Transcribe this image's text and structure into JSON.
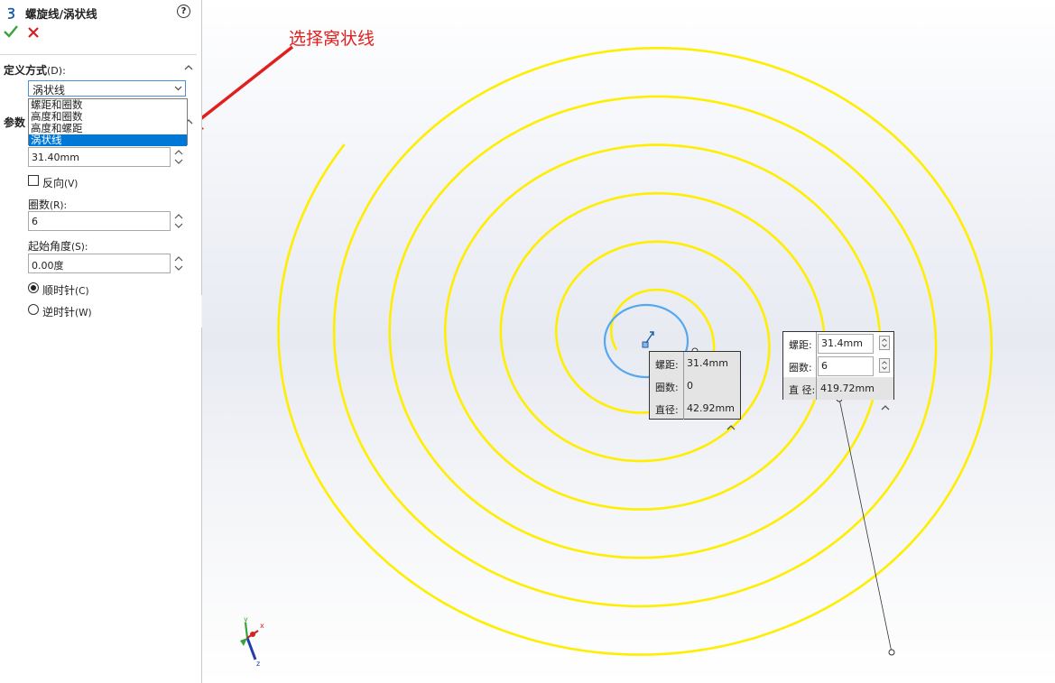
{
  "panel": {
    "title": "螺旋线/涡状线",
    "help_icon": "?",
    "define": {
      "header": "定义方式",
      "header_key": "(D):",
      "selected": "涡状线",
      "options": [
        "螺距和圈数",
        "高度和圈数",
        "高度和螺距",
        "涡状线"
      ]
    },
    "params": {
      "header": "参数",
      "pitch_value": "31.40mm",
      "reverse_label": "反向",
      "reverse_key": "(V)",
      "turns_label": "圈数",
      "turns_key": "(R):",
      "turns_value": "6",
      "angle_label": "起始角度",
      "angle_key": "(S):",
      "angle_value": "0.00度",
      "cw_label": "顺时针",
      "cw_key": "(C)",
      "ccw_label": "逆时针",
      "ccw_key": "(W)"
    }
  },
  "viewport": {
    "annotation": "选择窝状线",
    "dim_left": [
      {
        "key": "螺距:",
        "value": "31.4mm"
      },
      {
        "key": "圈数:",
        "value": "0"
      },
      {
        "key": "直径:",
        "value": "42.92mm"
      }
    ],
    "dim_right": [
      {
        "key": "螺距:",
        "value": "31.4mm"
      },
      {
        "key": "圈数:",
        "value": "6"
      },
      {
        "key": "直 径:",
        "value": "419.72mm"
      }
    ],
    "triad": {
      "x": "x",
      "y": "y",
      "z": "z"
    }
  },
  "colors": {
    "spiral": "#ffee00",
    "preview": "#55a8ee",
    "accent": "#0078d7",
    "callout": "#e21f1f"
  }
}
